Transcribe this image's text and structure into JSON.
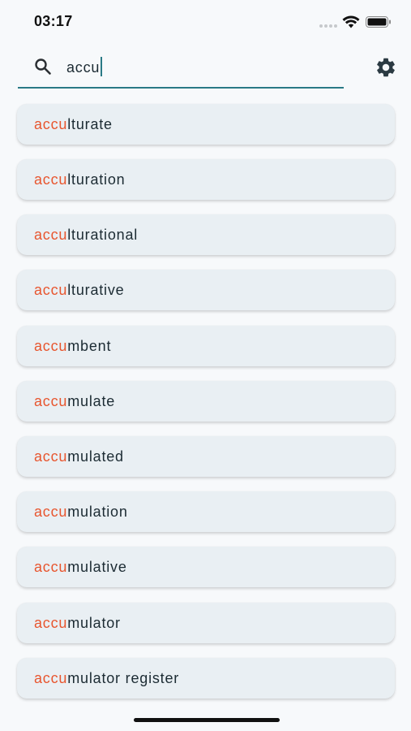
{
  "status_bar": {
    "time": "03:17",
    "icons": [
      "signal-dots-icon",
      "wifi-icon",
      "battery-icon"
    ]
  },
  "search": {
    "value": "accu",
    "icon": "search-icon",
    "underline_color": "#2a7a86"
  },
  "settings": {
    "icon": "gear-icon"
  },
  "results": [
    {
      "match": "accu",
      "rest": "lturate"
    },
    {
      "match": "accu",
      "rest": "lturation"
    },
    {
      "match": "accu",
      "rest": "lturational"
    },
    {
      "match": "accu",
      "rest": "lturative"
    },
    {
      "match": "accu",
      "rest": "mbent"
    },
    {
      "match": "accu",
      "rest": "mulate"
    },
    {
      "match": "accu",
      "rest": "mulated"
    },
    {
      "match": "accu",
      "rest": "mulation"
    },
    {
      "match": "accu",
      "rest": "mulative"
    },
    {
      "match": "accu",
      "rest": "mulator"
    },
    {
      "match": "accu",
      "rest": "mulator register"
    }
  ],
  "colors": {
    "highlight": "#e8552e",
    "card_background": "#e9eff3",
    "page_background": "#f7f9fb",
    "accent": "#2a7a86"
  }
}
